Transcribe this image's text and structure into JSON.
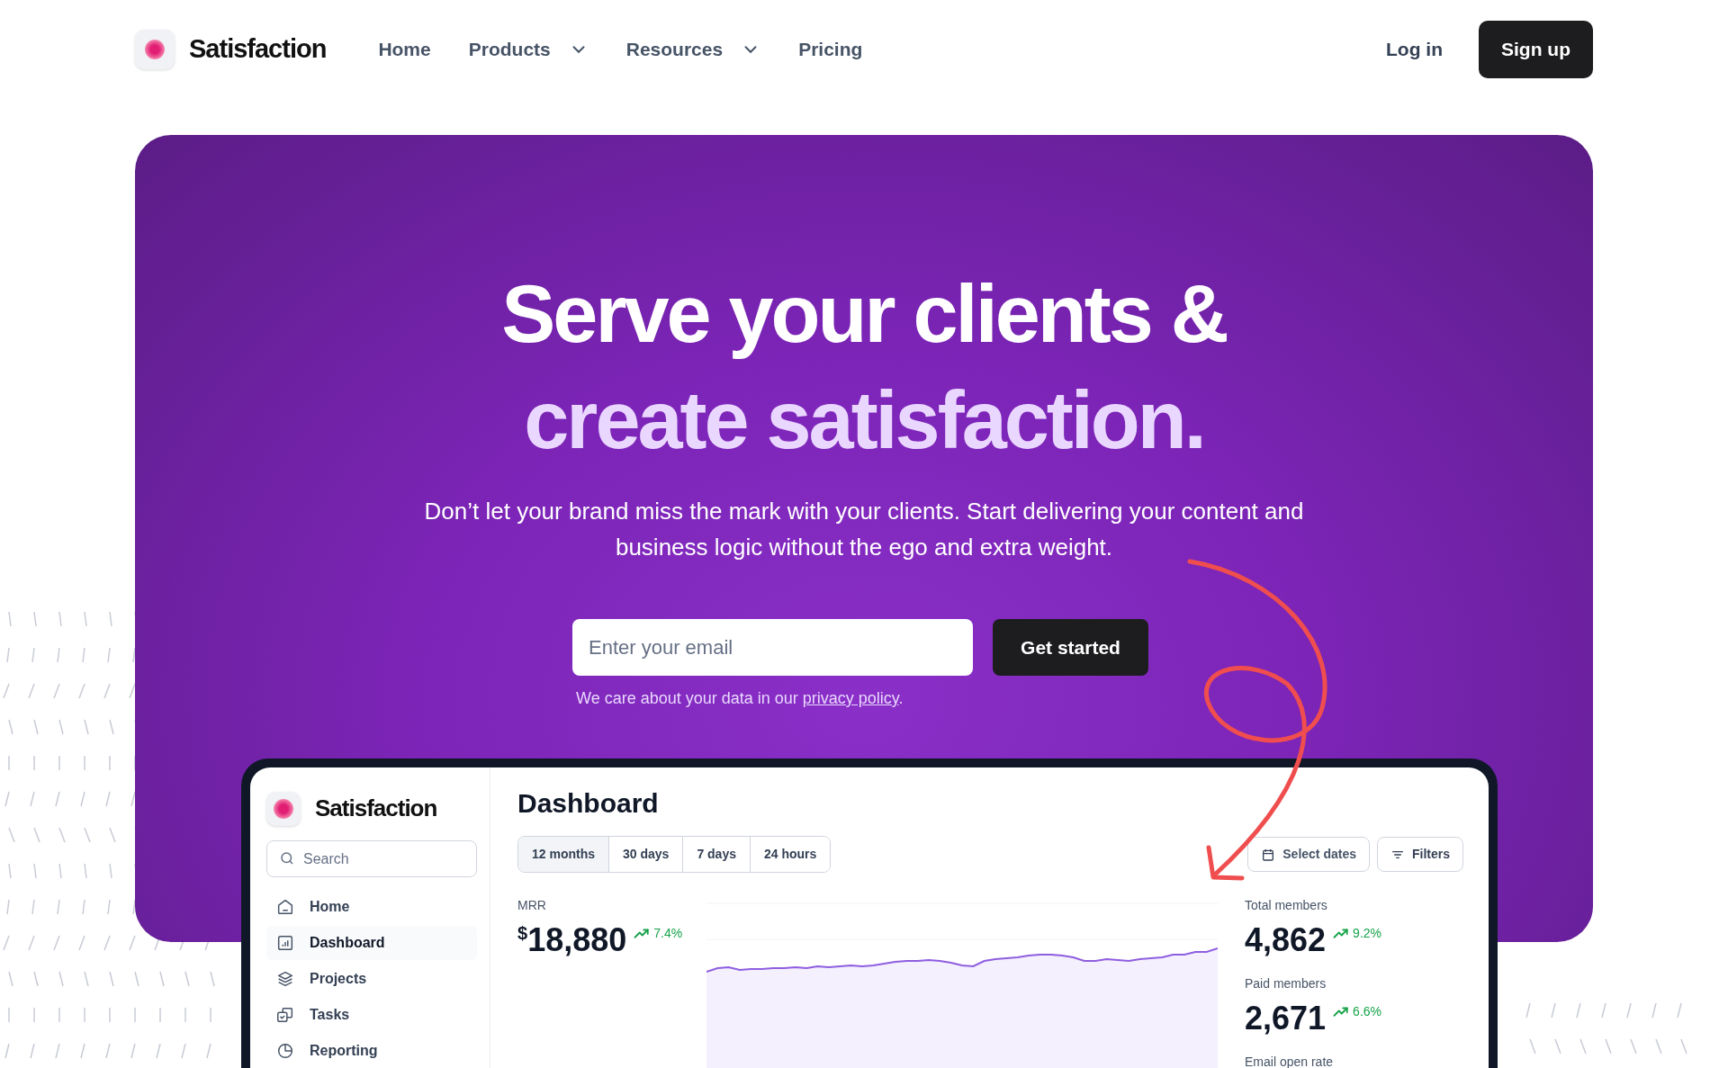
{
  "header": {
    "logo": "Satisfaction",
    "nav": [
      {
        "label": "Home",
        "dropdown": false
      },
      {
        "label": "Products",
        "dropdown": true
      },
      {
        "label": "Resources",
        "dropdown": true
      },
      {
        "label": "Pricing",
        "dropdown": false
      }
    ],
    "login": "Log in",
    "signup": "Sign up"
  },
  "hero": {
    "title_lines": [
      "Serve your clients &",
      "create satisfaction."
    ],
    "subtitle": "Don’t let your brand miss the mark with your clients. Start delivering your content and business logic without the ego and extra weight.",
    "email_placeholder": "Enter your email",
    "cta": "Get started",
    "privacy_note": {
      "text": "We care about your data in our ",
      "link": "privacy policy",
      "end": "."
    }
  },
  "dashboard": {
    "logo": "Satisfaction",
    "search_placeholder": "Search",
    "nav": [
      {
        "label": "Home",
        "selected": false
      },
      {
        "label": "Dashboard",
        "selected": true
      },
      {
        "label": "Projects",
        "selected": false
      },
      {
        "label": "Tasks",
        "selected": false
      },
      {
        "label": "Reporting",
        "selected": false
      }
    ],
    "title": "Dashboard",
    "ranges": [
      {
        "label": "12 months",
        "selected": true
      },
      {
        "label": "30 days",
        "selected": false
      },
      {
        "label": "7 days",
        "selected": false
      },
      {
        "label": "24 hours",
        "selected": false
      }
    ],
    "select_dates": "Select dates",
    "filters": "Filters",
    "mrr": {
      "label": "MRR",
      "currency": "$",
      "value": "18,880",
      "change": "7.4%"
    },
    "stats": [
      {
        "label": "Total members",
        "value": "4,862",
        "change": "9.2%"
      },
      {
        "label": "Paid members",
        "value": "2,671",
        "change": "6.6%"
      },
      {
        "label": "Email open rate"
      }
    ]
  }
}
